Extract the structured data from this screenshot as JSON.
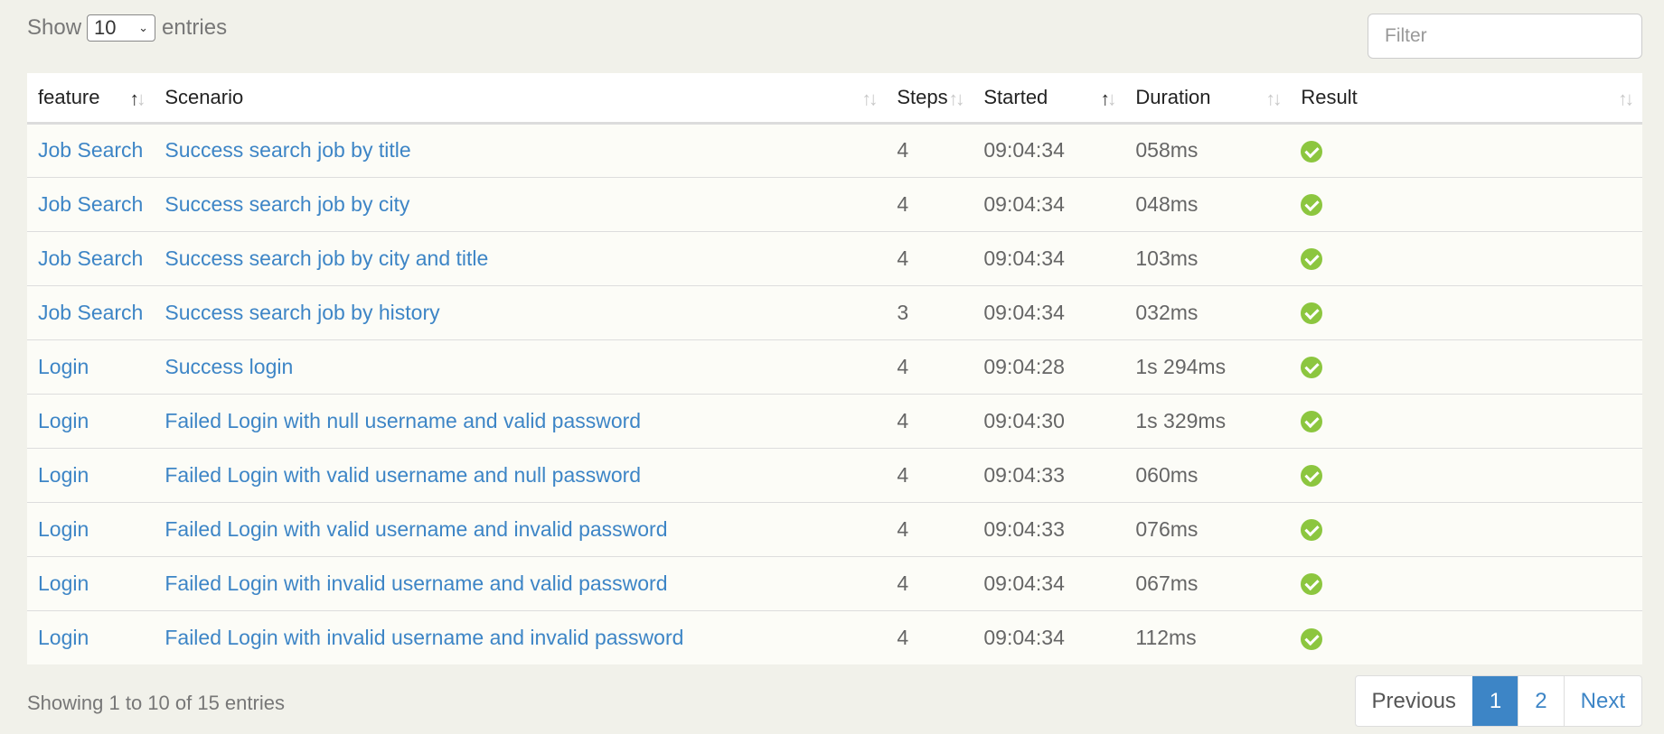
{
  "length_control": {
    "show_label": "Show",
    "selected": "10",
    "entries_label": "entries"
  },
  "filter": {
    "placeholder": "Filter",
    "value": ""
  },
  "table": {
    "columns": [
      {
        "label": "feature",
        "sort_state": "asc"
      },
      {
        "label": "Scenario",
        "sort_state": "none"
      },
      {
        "label": "Steps",
        "sort_state": "none"
      },
      {
        "label": "Started",
        "sort_state": "asc"
      },
      {
        "label": "Duration",
        "sort_state": "none"
      },
      {
        "label": "Result",
        "sort_state": "none"
      }
    ],
    "rows": [
      {
        "feature": "Job Search",
        "scenario": "Success search job by title",
        "steps": "4",
        "started": "09:04:34",
        "duration": "058ms",
        "result": "passed"
      },
      {
        "feature": "Job Search",
        "scenario": "Success search job by city",
        "steps": "4",
        "started": "09:04:34",
        "duration": "048ms",
        "result": "passed"
      },
      {
        "feature": "Job Search",
        "scenario": "Success search job by city and title",
        "steps": "4",
        "started": "09:04:34",
        "duration": "103ms",
        "result": "passed"
      },
      {
        "feature": "Job Search",
        "scenario": "Success search job by history",
        "steps": "3",
        "started": "09:04:34",
        "duration": "032ms",
        "result": "passed"
      },
      {
        "feature": "Login",
        "scenario": "Success login",
        "steps": "4",
        "started": "09:04:28",
        "duration": "1s 294ms",
        "result": "passed"
      },
      {
        "feature": "Login",
        "scenario": "Failed Login with null username and valid password",
        "steps": "4",
        "started": "09:04:30",
        "duration": "1s 329ms",
        "result": "passed"
      },
      {
        "feature": "Login",
        "scenario": "Failed Login with valid username and null password",
        "steps": "4",
        "started": "09:04:33",
        "duration": "060ms",
        "result": "passed"
      },
      {
        "feature": "Login",
        "scenario": "Failed Login with valid username and invalid password",
        "steps": "4",
        "started": "09:04:33",
        "duration": "076ms",
        "result": "passed"
      },
      {
        "feature": "Login",
        "scenario": "Failed Login with invalid username and valid password",
        "steps": "4",
        "started": "09:04:34",
        "duration": "067ms",
        "result": "passed"
      },
      {
        "feature": "Login",
        "scenario": "Failed Login with invalid username and invalid password",
        "steps": "4",
        "started": "09:04:34",
        "duration": "112ms",
        "result": "passed"
      }
    ]
  },
  "info_text": "Showing 1 to 10 of 15 entries",
  "pagination": {
    "previous": "Previous",
    "pages": [
      "1",
      "2"
    ],
    "current": "1",
    "next": "Next"
  },
  "colors": {
    "link": "#3d85c6",
    "passed": "#8cc63f",
    "active_page": "#3d85c6"
  },
  "icons": {
    "sort": "sort-arrows-icon",
    "result_passed": "check-circle-icon",
    "dropdown": "chevron-down-icon"
  }
}
